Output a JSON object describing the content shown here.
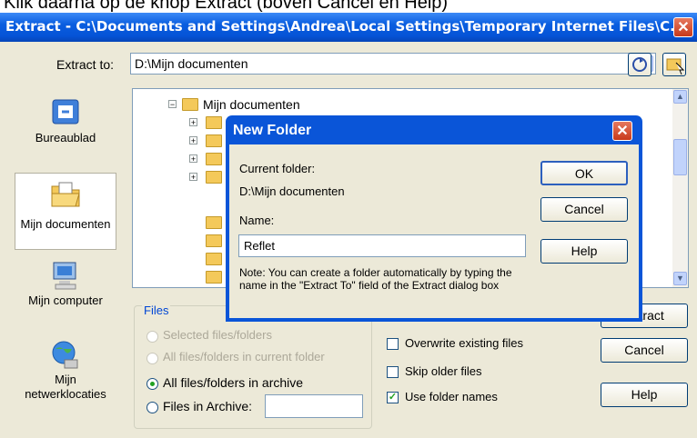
{
  "caption": "Klik daarna op de knop Extract (boven Cancel en Help)",
  "window": {
    "title": "Extract - C:\\Documents and Settings\\Andrea\\Local Settings\\Temporary Internet Files\\C...",
    "close": "✕"
  },
  "extract_to": {
    "label": "Extract to:",
    "value": "D:\\Mijn documenten"
  },
  "places": [
    {
      "label": "Bureaublad",
      "icon": "desktop-icon"
    },
    {
      "label": "Mijn documenten",
      "icon": "my-documents-icon"
    },
    {
      "label": "Mijn computer",
      "icon": "my-computer-icon"
    },
    {
      "label": "Mijn netwerklocaties",
      "icon": "network-places-icon"
    }
  ],
  "tree": {
    "root": "Mijn documenten"
  },
  "files_group": {
    "title": "Files",
    "options": [
      {
        "label": "Selected files/folders",
        "enabled": false,
        "selected": false
      },
      {
        "label": "All files/folders in current folder",
        "enabled": false,
        "selected": false
      },
      {
        "label": "All files/folders in archive",
        "enabled": true,
        "selected": true
      },
      {
        "label": "Files in Archive:",
        "enabled": true,
        "selected": false
      }
    ],
    "files_value": ""
  },
  "checkboxes": [
    {
      "label": "Overwrite existing files",
      "checked": false
    },
    {
      "label": "Skip older files",
      "checked": false
    },
    {
      "label": "Use folder names",
      "checked": true
    }
  ],
  "buttons": {
    "extract": "Extract",
    "cancel": "Cancel",
    "help": "Help"
  },
  "new_folder_dialog": {
    "title": "New Folder",
    "current_folder_label": "Current folder:",
    "current_folder_value": "D:\\Mijn documenten",
    "name_label": "Name:",
    "name_value": "Reflet",
    "note": "Note: You can create a folder automatically by typing the name in the \"Extract To\" field of the Extract dialog box",
    "ok": "OK",
    "cancel": "Cancel",
    "help": "Help"
  }
}
